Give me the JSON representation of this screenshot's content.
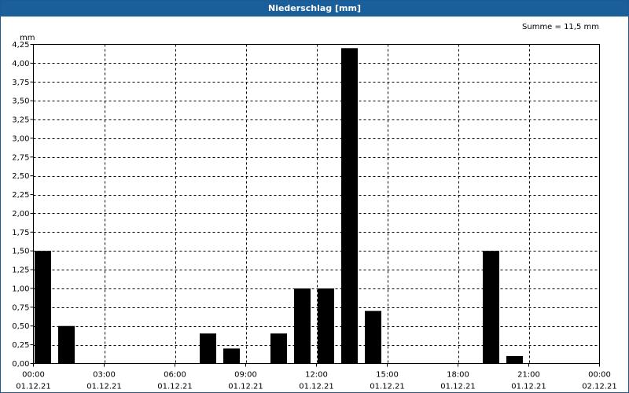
{
  "window": {
    "title": "Niederschlag [mm]"
  },
  "chart_data": {
    "type": "bar",
    "title": "Niederschlag [mm]",
    "ylabel": "mm",
    "summary": "Summe = 11,5 mm",
    "ylim": [
      0,
      4.25
    ],
    "y_ticks": [
      "0,00",
      "0,25",
      "0,50",
      "0,75",
      "1,00",
      "1,25",
      "1,50",
      "1,75",
      "2,00",
      "2,25",
      "2,50",
      "2,75",
      "3,00",
      "3,25",
      "3,50",
      "3,75",
      "4,00",
      "4,25"
    ],
    "x_ticks": [
      {
        "time": "00:00",
        "date": "01.12.21"
      },
      {
        "time": "03:00",
        "date": "01.12.21"
      },
      {
        "time": "06:00",
        "date": "01.12.21"
      },
      {
        "time": "09:00",
        "date": "01.12.21"
      },
      {
        "time": "12:00",
        "date": "01.12.21"
      },
      {
        "time": "15:00",
        "date": "01.12.21"
      },
      {
        "time": "18:00",
        "date": "01.12.21"
      },
      {
        "time": "21:00",
        "date": "01.12.21"
      },
      {
        "time": "00:00",
        "date": "02.12.21"
      }
    ],
    "categories": [
      "00:00",
      "01:00",
      "02:00",
      "03:00",
      "04:00",
      "05:00",
      "06:00",
      "07:00",
      "08:00",
      "09:00",
      "10:00",
      "11:00",
      "12:00",
      "13:00",
      "14:00",
      "15:00",
      "16:00",
      "17:00",
      "18:00",
      "19:00",
      "20:00",
      "21:00",
      "22:00",
      "23:00"
    ],
    "values": [
      1.5,
      0.5,
      0,
      0,
      0,
      0,
      0,
      0.4,
      0.2,
      0,
      0.4,
      1.0,
      1.0,
      4.2,
      0.7,
      0,
      0,
      0,
      0,
      1.5,
      0.1,
      0,
      0,
      0
    ],
    "bar_color": "#000000",
    "grid": true
  }
}
